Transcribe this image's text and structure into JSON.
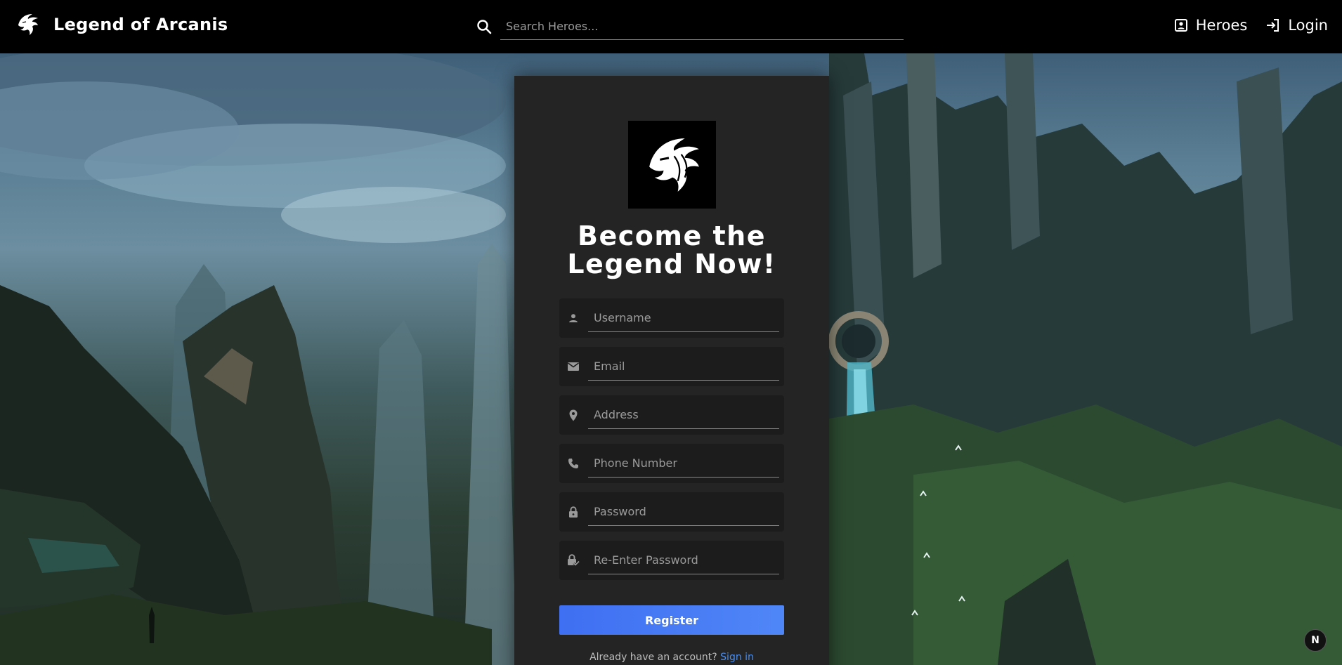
{
  "header": {
    "title": "Legend of Arcanis",
    "logo_icon": "dragon-head-icon",
    "search": {
      "placeholder": "Search Heroes...",
      "value": "",
      "icon": "search-icon"
    },
    "nav": [
      {
        "label": "Heroes",
        "icon": "person-box-icon"
      },
      {
        "label": "Login",
        "icon": "login-arrow-icon"
      }
    ]
  },
  "register_card": {
    "logo_icon": "dragon-head-icon",
    "heading_line1": "Become the",
    "heading_line2": "Legend Now!",
    "fields": [
      {
        "placeholder": "Username",
        "value": "",
        "icon": "person-icon"
      },
      {
        "placeholder": "Email",
        "value": "",
        "icon": "envelope-icon"
      },
      {
        "placeholder": "Address",
        "value": "",
        "icon": "location-pin-icon"
      },
      {
        "placeholder": "Phone Number",
        "value": "",
        "icon": "phone-icon"
      },
      {
        "placeholder": "Password",
        "value": "",
        "icon": "lock-icon"
      },
      {
        "placeholder": "Re-Enter Password",
        "value": "",
        "icon": "lock-check-icon"
      }
    ],
    "register_label": "Register",
    "signin_prompt": "Already have an account?",
    "signin_link": "Sign in"
  },
  "badge": {
    "label": "N"
  },
  "colors": {
    "appbar": "#000000",
    "card": "#242424",
    "field_bg": "#1c1c1c",
    "button": "#4a7cf5",
    "link": "#4a8ef0"
  }
}
